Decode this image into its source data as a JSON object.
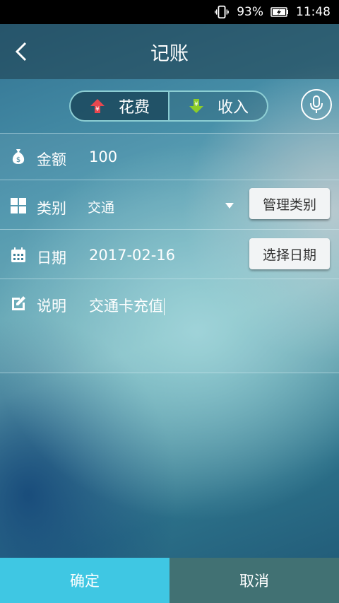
{
  "status_bar": {
    "battery": "93%",
    "time": "11:48"
  },
  "header": {
    "title": "记账"
  },
  "type_toggle": {
    "expense_label": "花费",
    "income_label": "收入",
    "selected": "expense",
    "expense_color": "#e8474f",
    "income_color": "#8ccc29"
  },
  "form": {
    "amount": {
      "label": "金额",
      "value": "100"
    },
    "category": {
      "label": "类别",
      "value": "交通",
      "manage_button": "管理类别"
    },
    "date": {
      "label": "日期",
      "value": "2017-02-16",
      "pick_button": "选择日期"
    },
    "note": {
      "label": "说明",
      "value": "交通卡充值"
    }
  },
  "footer": {
    "confirm_label": "确定",
    "cancel_label": "取消"
  },
  "colors": {
    "confirm": "#3fc7e3",
    "cancel": "#417173"
  }
}
